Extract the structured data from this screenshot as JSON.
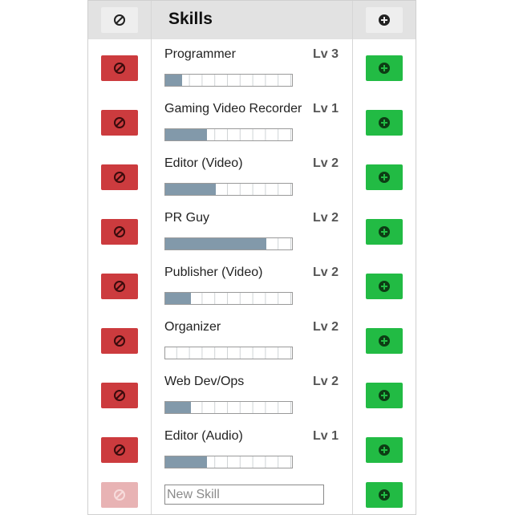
{
  "header": {
    "title": "Skills",
    "remove_icon": "forbidden-icon",
    "add_icon": "plus-circle-icon"
  },
  "skills": [
    {
      "name": "Programmer",
      "level": "Lv 3",
      "progress": 0.13
    },
    {
      "name": "Gaming Video Recorder",
      "level": "Lv 1",
      "progress": 0.33
    },
    {
      "name": "Editor (Video)",
      "level": "Lv 2",
      "progress": 0.4
    },
    {
      "name": "PR Guy",
      "level": "Lv 2",
      "progress": 0.8
    },
    {
      "name": "Publisher (Video)",
      "level": "Lv 2",
      "progress": 0.2
    },
    {
      "name": "Organizer",
      "level": "Lv 2",
      "progress": 0.0
    },
    {
      "name": "Web Dev/Ops",
      "level": "Lv 2",
      "progress": 0.2
    },
    {
      "name": "Editor (Audio)",
      "level": "Lv 1",
      "progress": 0.33
    }
  ],
  "new_skill": {
    "placeholder": "New Skill",
    "value": ""
  },
  "colors": {
    "remove": "#cc3b3e",
    "remove_disabled": "#e8b3b4",
    "add": "#22bb44",
    "progress": "#8299aa",
    "header_bg": "#e2e2e2"
  }
}
